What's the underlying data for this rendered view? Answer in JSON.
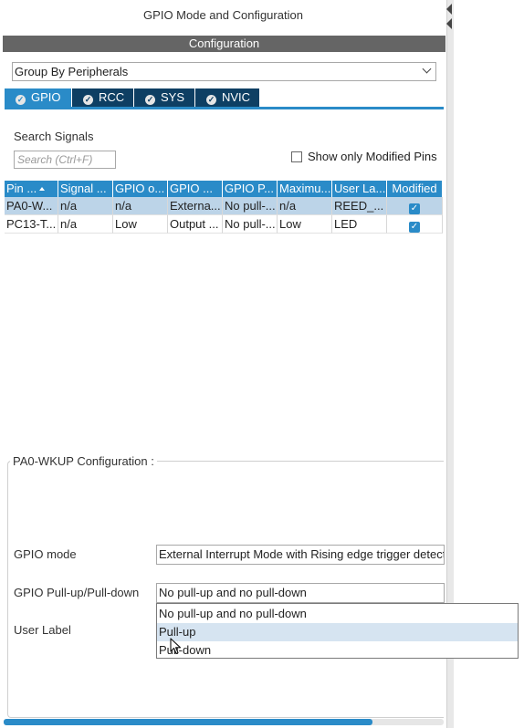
{
  "window": {
    "title": "GPIO Mode and Configuration"
  },
  "config_header": "Configuration",
  "group_select": {
    "value": "Group By Peripherals"
  },
  "tabs": [
    {
      "label": "GPIO",
      "active": true
    },
    {
      "label": "RCC",
      "active": false
    },
    {
      "label": "SYS",
      "active": false
    },
    {
      "label": "NVIC",
      "active": false
    }
  ],
  "search": {
    "label": "Search Signals",
    "placeholder": "Search (Ctrl+F)"
  },
  "show_modified": {
    "label": "Show only Modified Pins",
    "checked": false
  },
  "table": {
    "columns": [
      "Pin ...",
      "Signal ...",
      "GPIO o...",
      "GPIO ...",
      "GPIO P...",
      "Maximu...",
      "User La...",
      "Modified"
    ],
    "rows": [
      {
        "cells": [
          "PA0-W...",
          "n/a",
          "n/a",
          "Externa...",
          "No pull-...",
          "n/a",
          "REED_..."
        ],
        "modified": true,
        "selected": true
      },
      {
        "cells": [
          "PC13-T...",
          "n/a",
          "Low",
          "Output ...",
          "No pull-...",
          "Low",
          "LED"
        ],
        "modified": true,
        "selected": false
      }
    ]
  },
  "config_section": {
    "title": "PA0-WKUP Configuration :",
    "gpio_mode": {
      "label": "GPIO mode",
      "value": "External Interrupt Mode with Rising edge trigger detect"
    },
    "gpio_pull": {
      "label": "GPIO Pull-up/Pull-down",
      "value": "No pull-up and no pull-down"
    },
    "user_label": {
      "label": "User Label"
    }
  },
  "pull_dropdown": {
    "options": [
      "No pull-up and no pull-down",
      "Pull-up",
      "Pull-down"
    ],
    "highlighted": "Pull-up"
  },
  "colors": {
    "accent": "#2a8bc8",
    "tab_dark": "#0e3f63",
    "header_gray": "#656565",
    "selected_row": "#bcd4e8"
  },
  "icons": [
    "check-circle-icon",
    "chevron-down-icon",
    "sort-up-icon",
    "checkbox-checked-icon",
    "mouse-pointer-icon"
  ]
}
